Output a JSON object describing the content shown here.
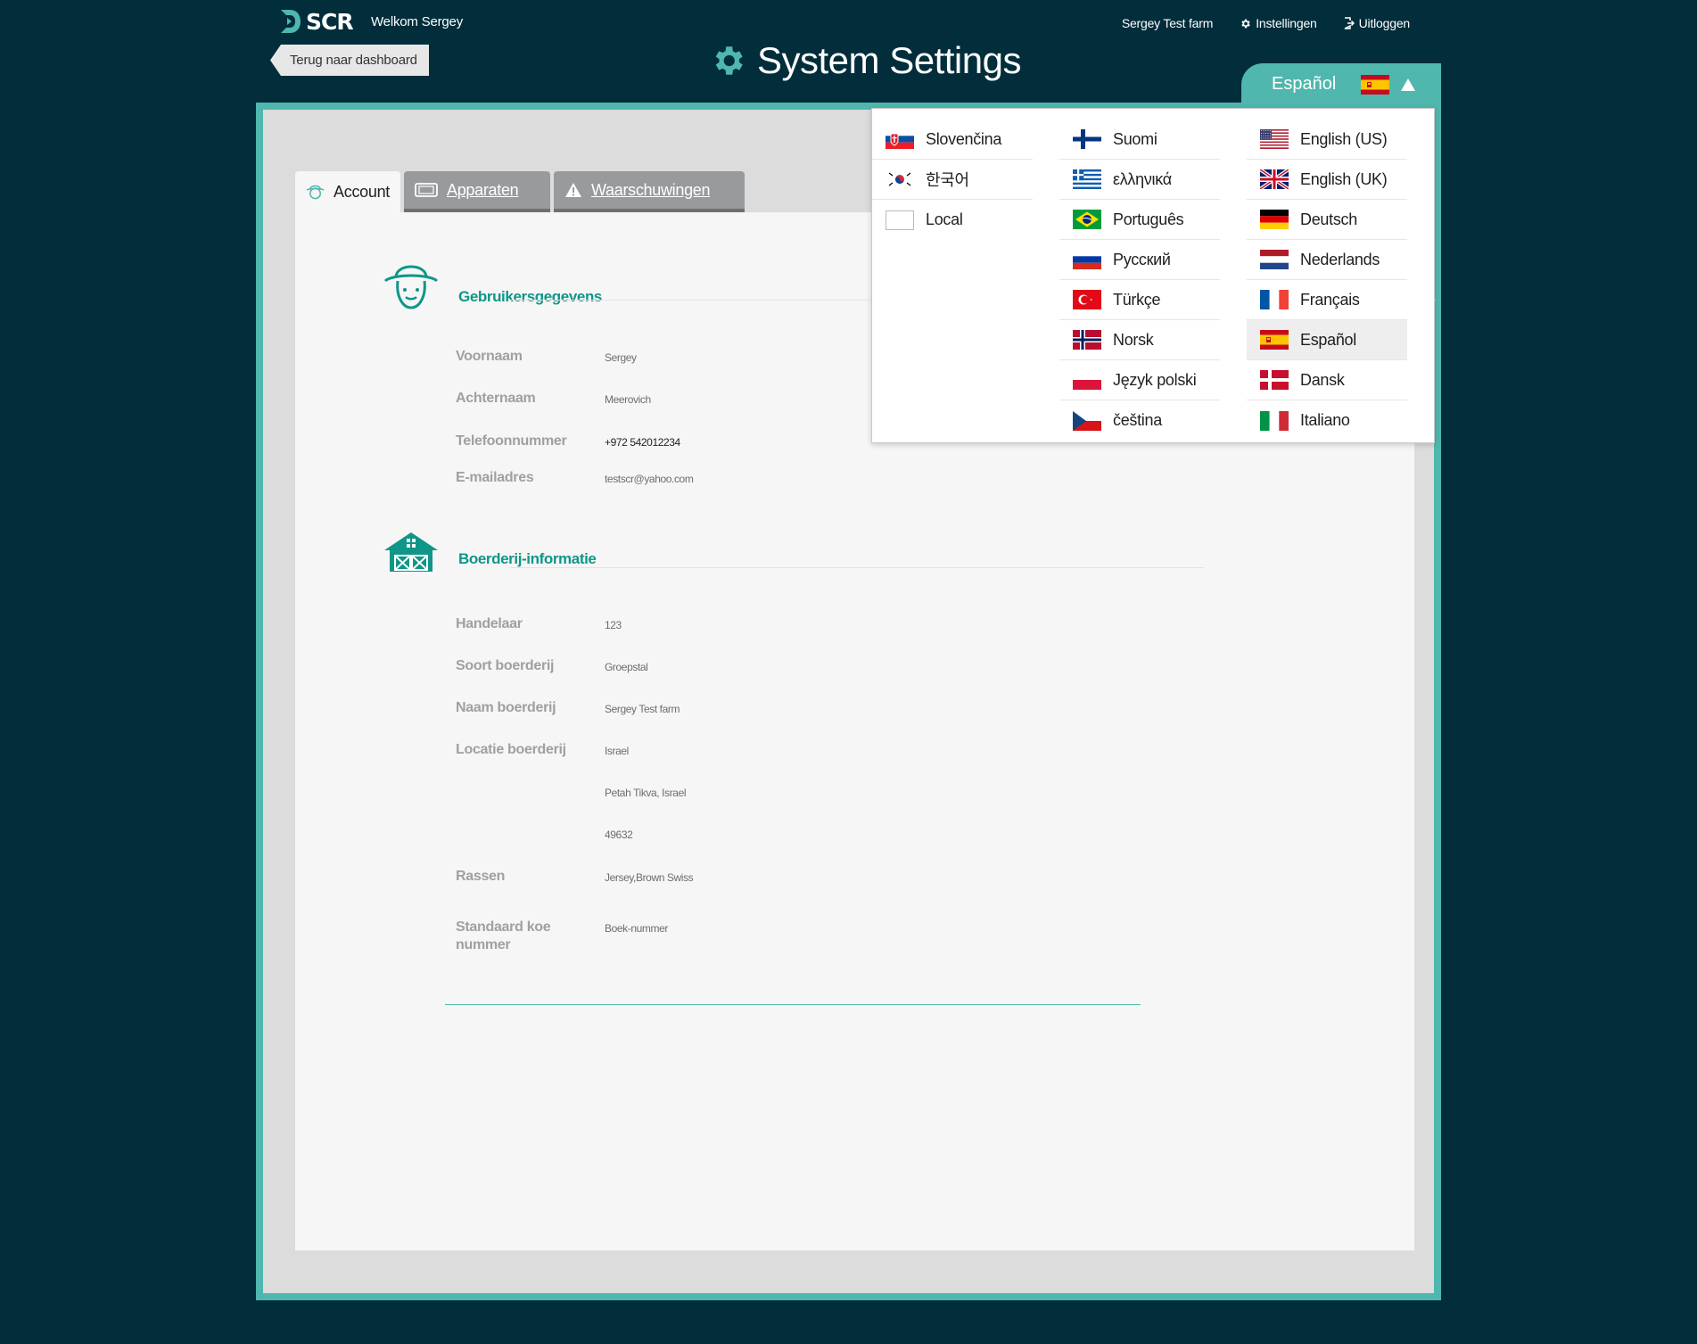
{
  "header": {
    "brand": "SCR",
    "welcome": "Welkom Sergey",
    "farm": "Sergey Test farm",
    "settings_label": "Instellingen",
    "logout_label": "Uitloggen",
    "back_label": "Terug naar dashboard",
    "page_title": "System Settings"
  },
  "language": {
    "current": "Español",
    "columns": [
      [
        {
          "label": "Slovenčina",
          "flag": "sk"
        },
        {
          "label": "한국어",
          "flag": "kr"
        },
        {
          "label": "Local",
          "flag": "blank"
        }
      ],
      [
        {
          "label": "Suomi",
          "flag": "fi"
        },
        {
          "label": "ελληνικά",
          "flag": "gr"
        },
        {
          "label": "Português",
          "flag": "br"
        },
        {
          "label": "Русский",
          "flag": "ru"
        },
        {
          "label": "Türkçe",
          "flag": "tr"
        },
        {
          "label": "Norsk",
          "flag": "no"
        },
        {
          "label": "Język polski",
          "flag": "pl"
        },
        {
          "label": "čeština",
          "flag": "cz"
        }
      ],
      [
        {
          "label": "English (US)",
          "flag": "us"
        },
        {
          "label": "English (UK)",
          "flag": "gb"
        },
        {
          "label": "Deutsch",
          "flag": "de"
        },
        {
          "label": "Nederlands",
          "flag": "nl"
        },
        {
          "label": "Français",
          "flag": "fr"
        },
        {
          "label": "Español",
          "flag": "es",
          "selected": true
        },
        {
          "label": "Dansk",
          "flag": "dk"
        },
        {
          "label": "Italiano",
          "flag": "it"
        }
      ]
    ]
  },
  "tabs": [
    {
      "label": "Account",
      "icon": "farmer-icon",
      "active": true
    },
    {
      "label": "Apparaten",
      "icon": "device-icon",
      "active": false
    },
    {
      "label": "Waarschuwingen",
      "icon": "warning-icon",
      "active": false
    }
  ],
  "user": {
    "title": "Gebruikersgegevens",
    "fields": [
      {
        "label": "Voornaam",
        "value": "Sergey"
      },
      {
        "label": "Achternaam",
        "value": "Meerovich"
      },
      {
        "label": "Telefoonnummer",
        "value": "+972 542012234"
      },
      {
        "label": "E-mailadres",
        "value": "testscr@yahoo.com"
      }
    ]
  },
  "farm": {
    "title": "Boerderij-informatie",
    "fields": [
      {
        "label": "Handelaar",
        "value": "123"
      },
      {
        "label": "Soort boerderij",
        "value": "Groepstal"
      },
      {
        "label": "Naam boerderij",
        "value": "Sergey Test farm"
      },
      {
        "label": "Locatie boerderij",
        "value": "Israel"
      },
      {
        "label": "",
        "value": "Petah Tikva, Israel"
      },
      {
        "label": "",
        "value": "49632"
      },
      {
        "label": "Rassen",
        "value": "Jersey,Brown Swiss"
      },
      {
        "label": "Standaard koe nummer",
        "value": "Boek-nummer"
      }
    ]
  },
  "colors": {
    "background": "#022d3b",
    "accent": "#4fb7ad",
    "section_title": "#0f9688"
  }
}
